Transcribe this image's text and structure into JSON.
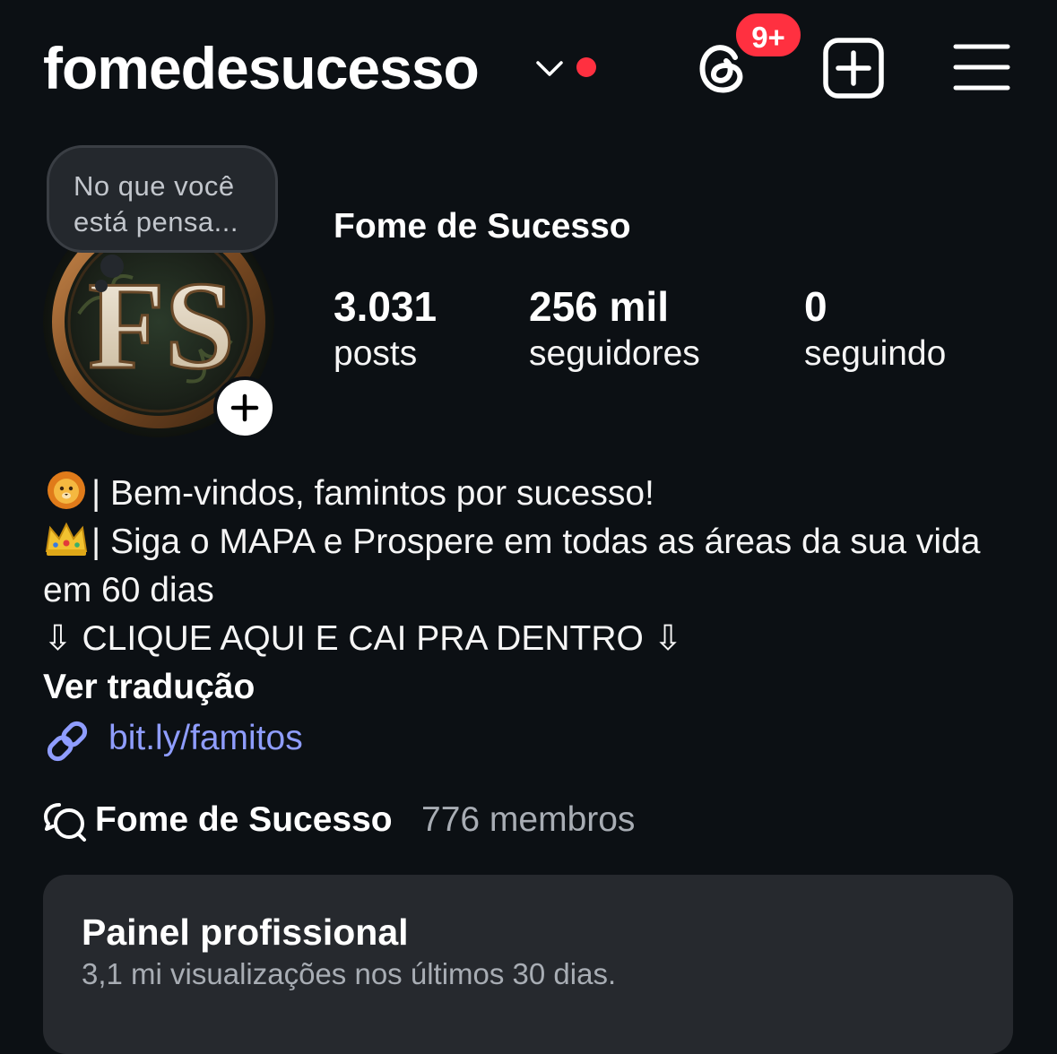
{
  "header": {
    "username": "fomedesucesso",
    "threads_badge": "9+"
  },
  "note": {
    "text": "No que você está pensa..."
  },
  "profile": {
    "display_name": "Fome de Sucesso",
    "avatar_monogram": "FS",
    "stats": [
      {
        "value": "3.031",
        "label": "posts"
      },
      {
        "value": "256 mil",
        "label": "seguidores"
      },
      {
        "value": "0",
        "label": "seguindo"
      }
    ]
  },
  "bio": {
    "line1": "| Bem-vindos, famintos por sucesso!",
    "line2": "| Siga o MAPA e Prospere em todas as áreas da sua vida em 60 dias",
    "line3": "⇩ CLIQUE AQUI E CAI PRA DENTRO ⇩",
    "translate_label": "Ver tradução",
    "link": "bit.ly/famitos",
    "icons": [
      "lion-emoji",
      "crown-emoji",
      "link-icon"
    ]
  },
  "channel": {
    "name": "Fome de Sucesso",
    "members": "776 membros"
  },
  "pro_panel": {
    "title": "Painel profissional",
    "subtitle": "3,1 mi visualizações nos últimos 30 dias."
  },
  "colors": {
    "background": "#0c1014",
    "notification_red": "#ff3040",
    "link_blue": "#8f9dff",
    "panel_bg": "#26292e"
  }
}
